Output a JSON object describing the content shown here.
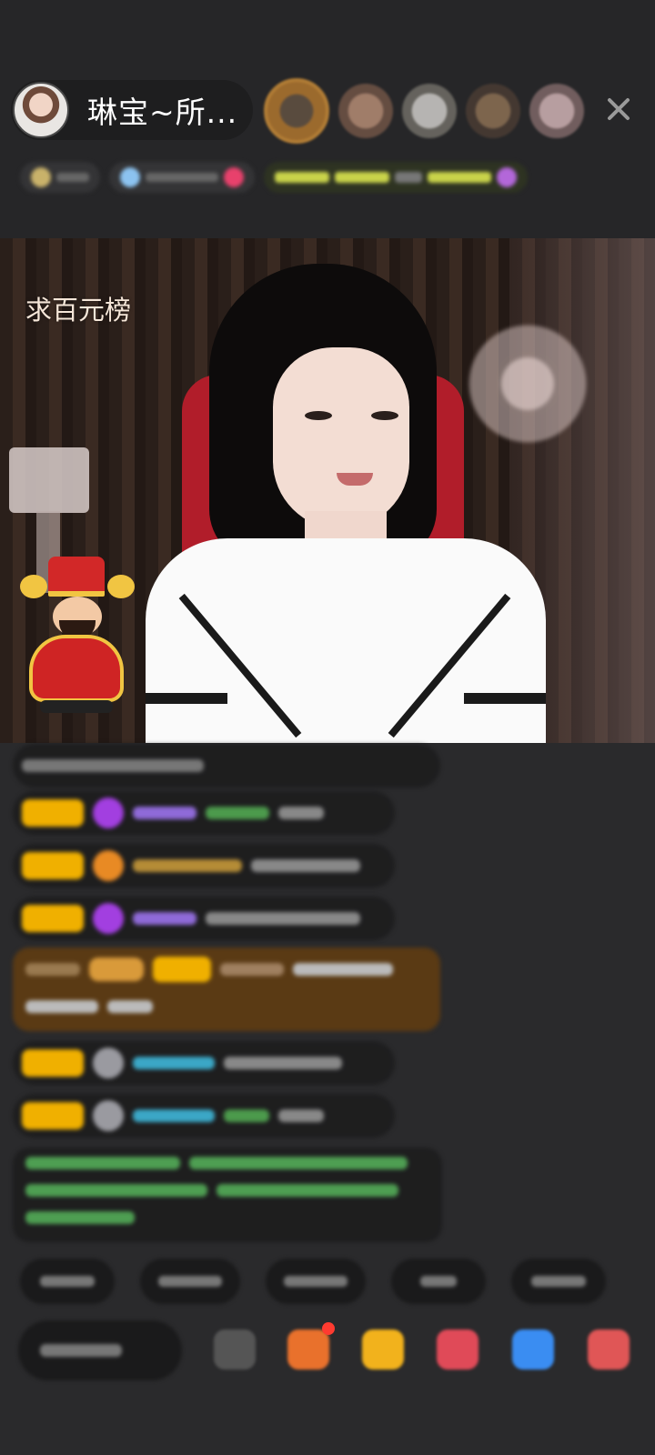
{
  "header": {
    "host_name": "琳宝~所...",
    "close_icon": "close-icon"
  },
  "video": {
    "overlay_text": "求百元榜"
  },
  "colors": {
    "background": "#2a2a2c",
    "badge_gold": "#f0b000",
    "chat_text_green": "#76c77a",
    "accent_red": "#ff3b30"
  }
}
